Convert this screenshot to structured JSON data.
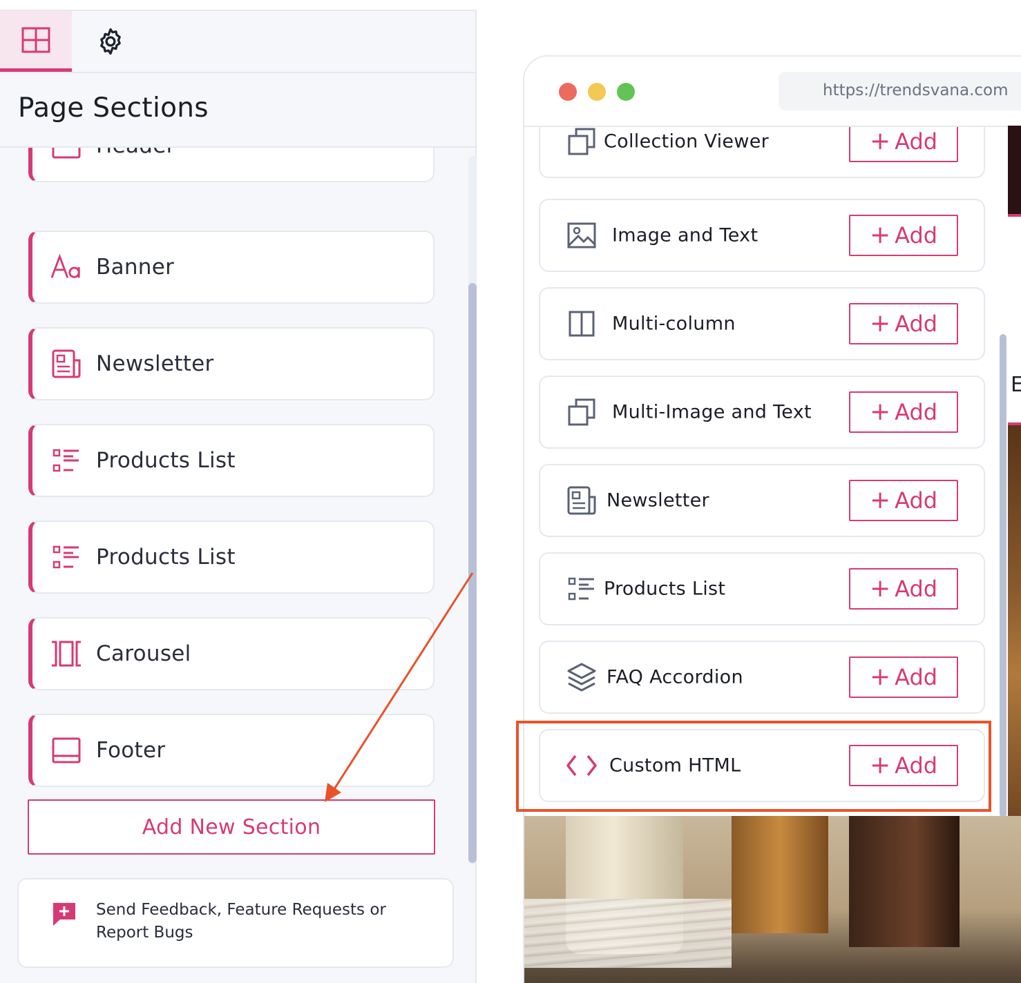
{
  "left_panel": {
    "tabs": [
      {
        "name": "sections",
        "icon": "grid-icon",
        "active": true
      },
      {
        "name": "settings",
        "icon": "gear-icon",
        "active": false
      }
    ],
    "title": "Page Sections",
    "sections": [
      {
        "label": "Header",
        "icon": "header-layout-icon"
      },
      {
        "label": "Banner",
        "icon": "text-font-icon"
      },
      {
        "label": "Newsletter",
        "icon": "newspaper-icon"
      },
      {
        "label": "Products List",
        "icon": "list-icon"
      },
      {
        "label": "Products List",
        "icon": "list-icon"
      },
      {
        "label": "Carousel",
        "icon": "carousel-icon"
      },
      {
        "label": "Footer",
        "icon": "footer-layout-icon"
      }
    ],
    "add_new_section_label": "Add New Section",
    "feedback_text": "Send Feedback, Feature Requests or Report Bugs"
  },
  "browser": {
    "url": "https://trendsvana.com",
    "page_partial_text": "E",
    "add_sections": [
      {
        "label": "Collection Viewer",
        "icon": "copy-icon",
        "button": "Add"
      },
      {
        "label": "Image and Text",
        "icon": "image-icon",
        "button": "Add"
      },
      {
        "label": "Multi-column",
        "icon": "columns-icon",
        "button": "Add"
      },
      {
        "label": "Multi-Image and Text",
        "icon": "copy-icon",
        "button": "Add"
      },
      {
        "label": "Newsletter",
        "icon": "newspaper-icon",
        "button": "Add"
      },
      {
        "label": "Products List",
        "icon": "list-icon",
        "button": "Add"
      },
      {
        "label": "FAQ Accordion",
        "icon": "layers-icon",
        "button": "Add"
      },
      {
        "label": "Custom HTML",
        "icon": "code-icon",
        "button": "Add",
        "highlighted": true
      }
    ]
  },
  "colors": {
    "accent": "#d63a76",
    "highlight": "#e8532a",
    "icon_gray": "#5b6275"
  }
}
